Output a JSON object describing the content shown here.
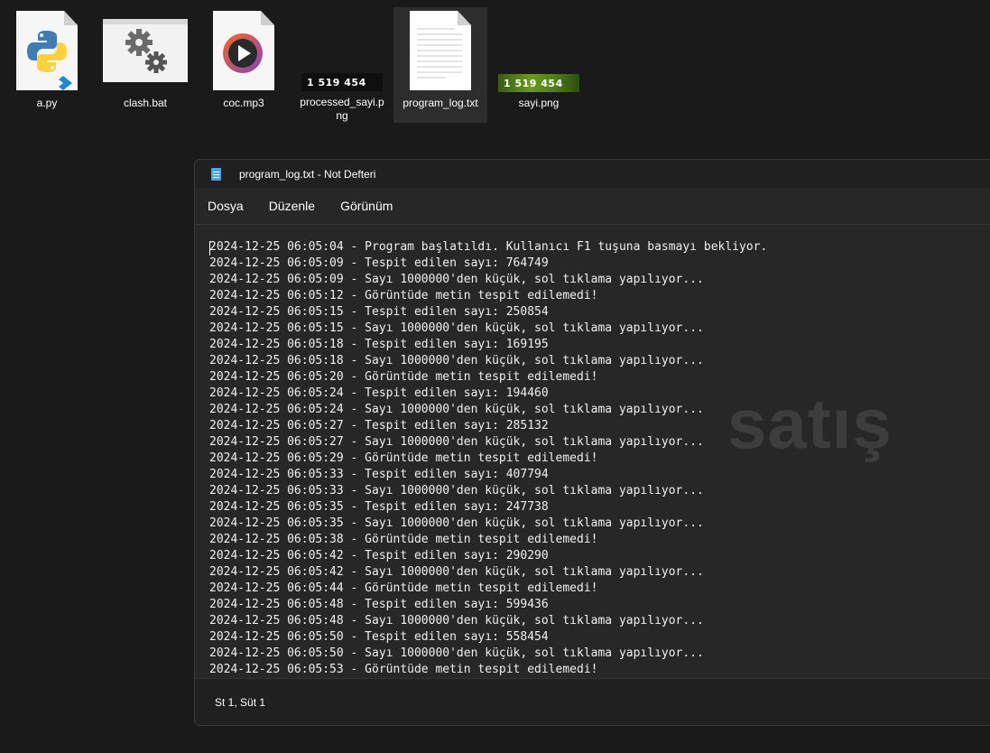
{
  "desktop": {
    "icons": [
      {
        "label": "a.py"
      },
      {
        "label": "clash.bat"
      },
      {
        "label": "coc.mp3"
      },
      {
        "label": "processed_sayi.png",
        "thumb_text": "1 519 454"
      },
      {
        "label": "program_log.txt"
      },
      {
        "label": "sayi.png",
        "thumb_text": "1 519 454"
      }
    ]
  },
  "window": {
    "title": "program_log.txt - Not Defteri",
    "menu": [
      "Dosya",
      "Düzenle",
      "Görünüm"
    ],
    "log_lines": [
      "2024-12-25 06:05:04 - Program başlatıldı. Kullanıcı F1 tuşuna basmayı bekliyor.",
      "2024-12-25 06:05:09 - Tespit edilen sayı: 764749",
      "2024-12-25 06:05:09 - Sayı 1000000'den küçük, sol tıklama yapılıyor...",
      "2024-12-25 06:05:12 - Görüntüde metin tespit edilemedi!",
      "2024-12-25 06:05:15 - Tespit edilen sayı: 250854",
      "2024-12-25 06:05:15 - Sayı 1000000'den küçük, sol tıklama yapılıyor...",
      "2024-12-25 06:05:18 - Tespit edilen sayı: 169195",
      "2024-12-25 06:05:18 - Sayı 1000000'den küçük, sol tıklama yapılıyor...",
      "2024-12-25 06:05:20 - Görüntüde metin tespit edilemedi!",
      "2024-12-25 06:05:24 - Tespit edilen sayı: 194460",
      "2024-12-25 06:05:24 - Sayı 1000000'den küçük, sol tıklama yapılıyor...",
      "2024-12-25 06:05:27 - Tespit edilen sayı: 285132",
      "2024-12-25 06:05:27 - Sayı 1000000'den küçük, sol tıklama yapılıyor...",
      "2024-12-25 06:05:29 - Görüntüde metin tespit edilemedi!",
      "2024-12-25 06:05:33 - Tespit edilen sayı: 407794",
      "2024-12-25 06:05:33 - Sayı 1000000'den küçük, sol tıklama yapılıyor...",
      "2024-12-25 06:05:35 - Tespit edilen sayı: 247738",
      "2024-12-25 06:05:35 - Sayı 1000000'den küçük, sol tıklama yapılıyor...",
      "2024-12-25 06:05:38 - Görüntüde metin tespit edilemedi!",
      "2024-12-25 06:05:42 - Tespit edilen sayı: 290290",
      "2024-12-25 06:05:42 - Sayı 1000000'den küçük, sol tıklama yapılıyor...",
      "2024-12-25 06:05:44 - Görüntüde metin tespit edilemedi!",
      "2024-12-25 06:05:48 - Tespit edilen sayı: 599436",
      "2024-12-25 06:05:48 - Sayı 1000000'den küçük, sol tıklama yapılıyor...",
      "2024-12-25 06:05:50 - Tespit edilen sayı: 558454",
      "2024-12-25 06:05:50 - Sayı 1000000'den küçük, sol tıklama yapılıyor...",
      "2024-12-25 06:05:53 - Görüntüde metin tespit edilemedi!"
    ],
    "status": "St 1, Süt 1",
    "watermark": "satış"
  },
  "colors": {
    "python_blue": "#3f7cb3",
    "python_yellow": "#ffd13f",
    "vscode_blue": "#1f8ad2",
    "player_orange": "#f26b2a",
    "player_purple": "#8a3fb8"
  }
}
